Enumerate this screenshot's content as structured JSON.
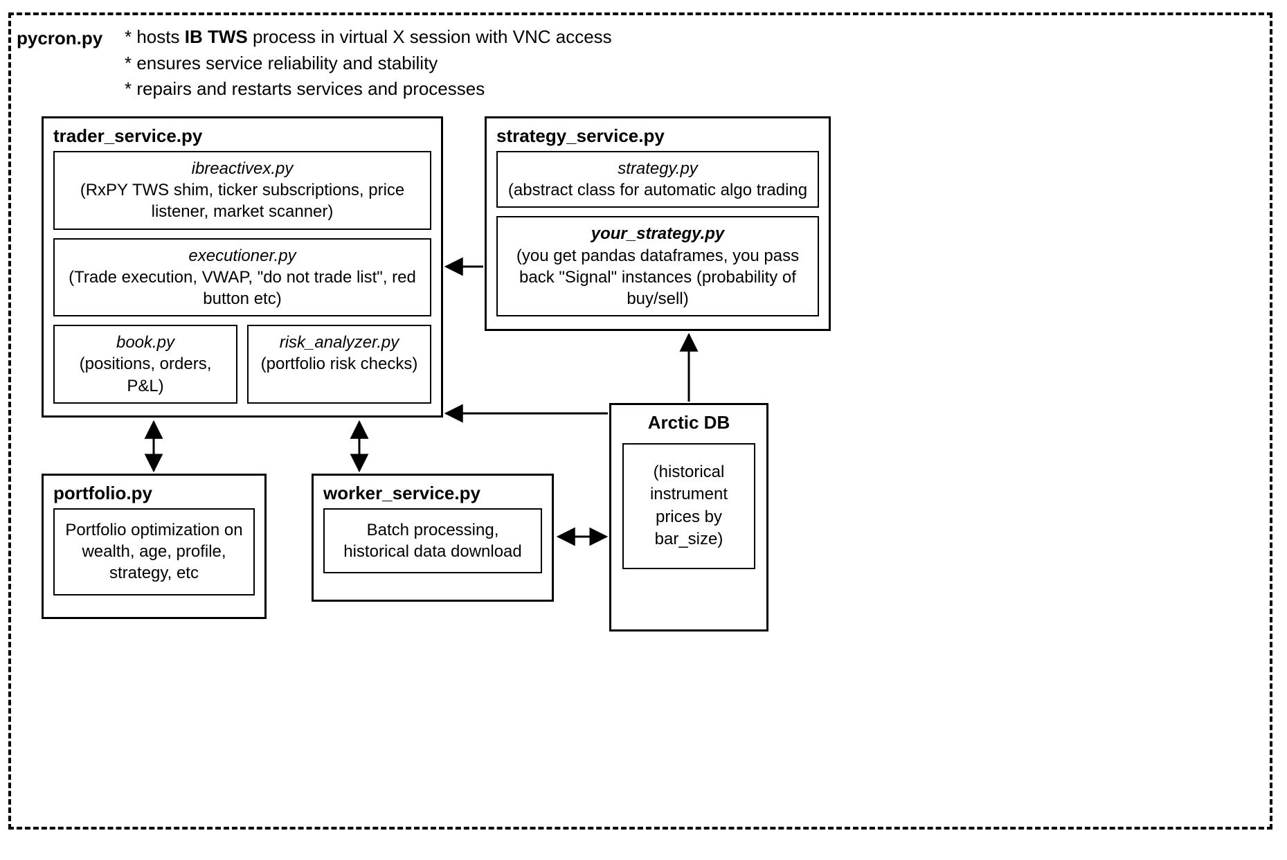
{
  "pycron": {
    "label": "pycron.py",
    "bullets": [
      {
        "prefix": "* hosts ",
        "bold": "IB TWS",
        "suffix": " process in virtual X session with VNC access"
      },
      {
        "text": "* ensures service reliability and stability"
      },
      {
        "text": "* repairs and restarts services and processes"
      }
    ]
  },
  "trader_service": {
    "title": "trader_service.py",
    "ibreactivex": {
      "title": "ibreactivex.py",
      "desc": "(RxPY TWS shim, ticker subscriptions, price listener, market scanner)"
    },
    "executioner": {
      "title": "executioner.py",
      "desc": "(Trade execution, VWAP, \"do not trade list\", red button etc)"
    },
    "book": {
      "title": "book.py",
      "desc": "(positions, orders, P&L)"
    },
    "risk": {
      "title": "risk_analyzer.py",
      "desc": "(portfolio risk checks)"
    }
  },
  "strategy_service": {
    "title": "strategy_service.py",
    "strategy": {
      "title": "strategy.py",
      "desc": "(abstract class for automatic algo trading"
    },
    "your_strategy": {
      "title": "your_strategy.py",
      "desc": "(you get pandas dataframes, you pass back \"Signal\" instances (probability of buy/sell)"
    }
  },
  "portfolio": {
    "title": "portfolio.py",
    "desc": "Portfolio optimization on wealth, age, profile, strategy, etc"
  },
  "worker_service": {
    "title": "worker_service.py",
    "desc": "Batch processing, historical data download"
  },
  "arctic": {
    "title": "Arctic DB",
    "desc": "(historical instrument prices by bar_size)"
  }
}
